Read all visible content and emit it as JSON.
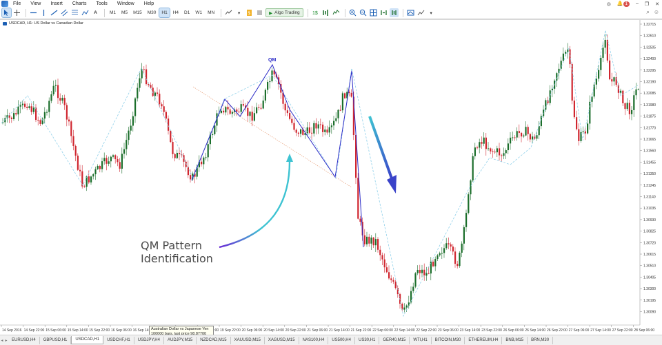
{
  "menu": [
    "File",
    "View",
    "Insert",
    "Charts",
    "Tools",
    "Window",
    "Help"
  ],
  "window_controls": {
    "notifications": "1"
  },
  "toolbar": {
    "timeframes": [
      "M1",
      "M5",
      "M15",
      "M30",
      "H1",
      "H4",
      "D1",
      "W1",
      "MN"
    ],
    "active_timeframe": "H1",
    "algo_label": "Algo Trading",
    "icons": [
      "cursor-icon",
      "crosshair-icon",
      "hline-icon",
      "vline-icon",
      "trendline-icon",
      "channel-icon",
      "fibo-icon",
      "shapes-icon",
      "text-icon",
      "indicator-icon",
      "objects-icon",
      "algo-icon",
      "one-click-icon",
      "depth-icon",
      "zoom-in-icon",
      "zoom-out-icon",
      "grid-icon",
      "autoscroll-icon",
      "shift-icon",
      "template-icon"
    ]
  },
  "chart": {
    "title": "USDCAD, H1: US Dollar vs Canadian Dollar",
    "annotation_line1": "QM Pattern",
    "annotation_line2": "Identification",
    "pattern_label": "QM",
    "tooltip_line1": "Australian Dollar vs Japanese Yen",
    "tooltip_line2": "100000 bars, last price 98.87700",
    "colors": {
      "bull": "#1b6e2b",
      "bear": "#d0262f",
      "pattern": "#2b2bc7",
      "arrow": "#3ec3d2"
    },
    "price_labels": [
      "1.32715",
      "1.32610",
      "1.32505",
      "1.32400",
      "1.32295",
      "1.32190",
      "1.32085",
      "1.31980",
      "1.31875",
      "1.31770",
      "1.31665",
      "1.31560",
      "1.31455",
      "1.31350",
      "1.31245",
      "1.31140",
      "1.31035",
      "1.30930",
      "1.30825",
      "1.30720",
      "1.30615",
      "1.30510",
      "1.30405",
      "1.30300",
      "1.30195",
      "1.30090"
    ],
    "time_labels": [
      "14 Sep 2016",
      "14 Sep 22:00",
      "15 Sep 06:00",
      "15 Sep 14:00",
      "15 Sep 22:00",
      "16 Sep 06:00",
      "16 Sep 14:00",
      "16 Sep 22:00",
      "19 Sep 06:00",
      "19 Sep 14:00",
      "19 Sep 22:00",
      "20 Sep 06:00",
      "20 Sep 14:00",
      "20 Sep 22:00",
      "21 Sep 06:00",
      "21 Sep 14:00",
      "21 Sep 22:00",
      "22 Sep 06:00",
      "22 Sep 14:00",
      "22 Sep 22:00",
      "23 Sep 06:00",
      "23 Sep 14:00",
      "23 Sep 22:00",
      "26 Sep 06:00",
      "26 Sep 14:00",
      "26 Sep 22:00",
      "27 Sep 06:00",
      "27 Sep 14:00",
      "27 Sep 22:00",
      "28 Sep 06:00"
    ]
  },
  "tabs": [
    "EURUSD,H4",
    "GBPUSD,H1",
    "USDCAD,H1",
    "USDCHF,H1",
    "USDJPY,H4",
    "AUDJPY,M15",
    "NZDCAD,M15",
    "XAUUSD,M15",
    "XAGUSD,M15",
    "NAS100,H4",
    "US500,H4",
    "US30,H1",
    "GER40,M15",
    "WTI,H1",
    "BITCOIN,M30",
    "ETHEREUM,H4",
    "BNB,M15",
    "BRN,M30"
  ],
  "active_tab": "USDCAD,H1"
}
